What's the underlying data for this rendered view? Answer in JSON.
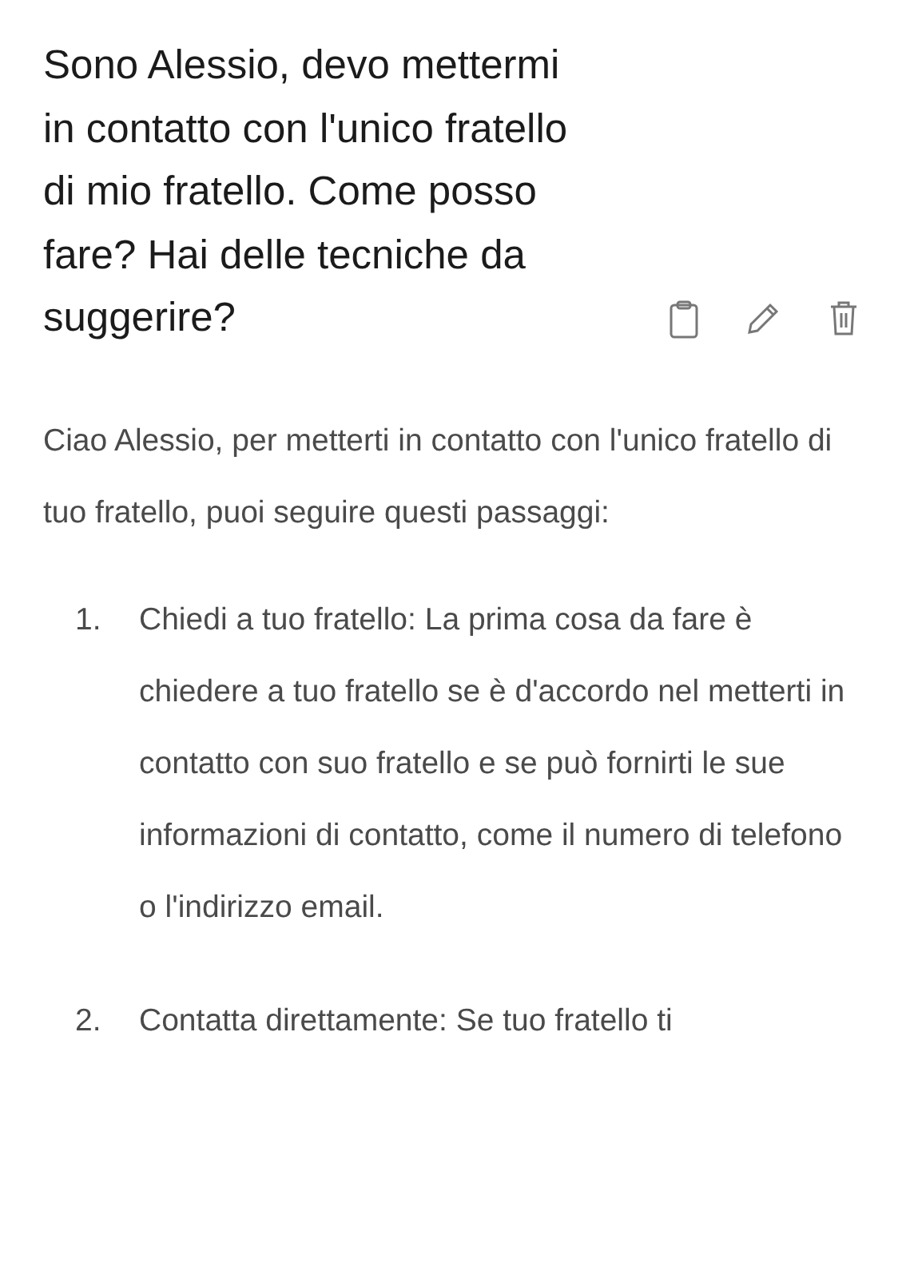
{
  "question": {
    "text": "Sono Alessio, devo mettermi in contatto con l'unico fratello di mio fratello. Come posso fare? Hai delle tecniche da suggerire?"
  },
  "answer": {
    "intro": "Ciao Alessio, per metterti in contatto con l'unico fratello di tuo fratello, puoi seguire questi passaggi:",
    "steps": [
      {
        "number": "1.",
        "text": "Chiedi a tuo fratello: La prima cosa da fare è chiedere a tuo fratello se è d'accordo nel metterti in contatto con suo fratello e se può fornirti le sue informazioni di contatto, come il numero di telefono o l'indirizzo email."
      },
      {
        "number": "2.",
        "text": "Contatta direttamente: Se tuo fratello ti"
      }
    ]
  }
}
